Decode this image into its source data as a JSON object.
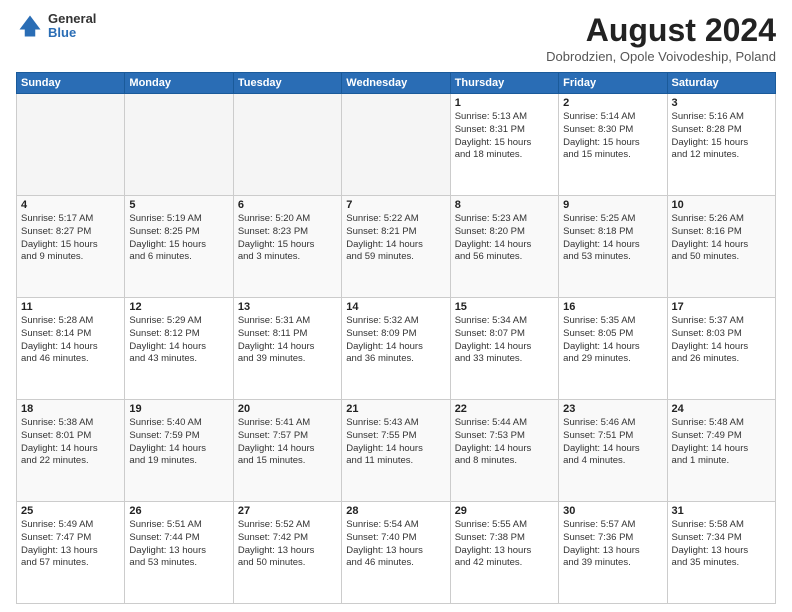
{
  "logo": {
    "general": "General",
    "blue": "Blue"
  },
  "title": "August 2024",
  "location": "Dobrodzien, Opole Voivodeship, Poland",
  "headers": [
    "Sunday",
    "Monday",
    "Tuesday",
    "Wednesday",
    "Thursday",
    "Friday",
    "Saturday"
  ],
  "rows": [
    [
      {
        "day": "",
        "lines": []
      },
      {
        "day": "",
        "lines": []
      },
      {
        "day": "",
        "lines": []
      },
      {
        "day": "",
        "lines": []
      },
      {
        "day": "1",
        "lines": [
          "Sunrise: 5:13 AM",
          "Sunset: 8:31 PM",
          "Daylight: 15 hours",
          "and 18 minutes."
        ]
      },
      {
        "day": "2",
        "lines": [
          "Sunrise: 5:14 AM",
          "Sunset: 8:30 PM",
          "Daylight: 15 hours",
          "and 15 minutes."
        ]
      },
      {
        "day": "3",
        "lines": [
          "Sunrise: 5:16 AM",
          "Sunset: 8:28 PM",
          "Daylight: 15 hours",
          "and 12 minutes."
        ]
      }
    ],
    [
      {
        "day": "4",
        "lines": [
          "Sunrise: 5:17 AM",
          "Sunset: 8:27 PM",
          "Daylight: 15 hours",
          "and 9 minutes."
        ]
      },
      {
        "day": "5",
        "lines": [
          "Sunrise: 5:19 AM",
          "Sunset: 8:25 PM",
          "Daylight: 15 hours",
          "and 6 minutes."
        ]
      },
      {
        "day": "6",
        "lines": [
          "Sunrise: 5:20 AM",
          "Sunset: 8:23 PM",
          "Daylight: 15 hours",
          "and 3 minutes."
        ]
      },
      {
        "day": "7",
        "lines": [
          "Sunrise: 5:22 AM",
          "Sunset: 8:21 PM",
          "Daylight: 14 hours",
          "and 59 minutes."
        ]
      },
      {
        "day": "8",
        "lines": [
          "Sunrise: 5:23 AM",
          "Sunset: 8:20 PM",
          "Daylight: 14 hours",
          "and 56 minutes."
        ]
      },
      {
        "day": "9",
        "lines": [
          "Sunrise: 5:25 AM",
          "Sunset: 8:18 PM",
          "Daylight: 14 hours",
          "and 53 minutes."
        ]
      },
      {
        "day": "10",
        "lines": [
          "Sunrise: 5:26 AM",
          "Sunset: 8:16 PM",
          "Daylight: 14 hours",
          "and 50 minutes."
        ]
      }
    ],
    [
      {
        "day": "11",
        "lines": [
          "Sunrise: 5:28 AM",
          "Sunset: 8:14 PM",
          "Daylight: 14 hours",
          "and 46 minutes."
        ]
      },
      {
        "day": "12",
        "lines": [
          "Sunrise: 5:29 AM",
          "Sunset: 8:12 PM",
          "Daylight: 14 hours",
          "and 43 minutes."
        ]
      },
      {
        "day": "13",
        "lines": [
          "Sunrise: 5:31 AM",
          "Sunset: 8:11 PM",
          "Daylight: 14 hours",
          "and 39 minutes."
        ]
      },
      {
        "day": "14",
        "lines": [
          "Sunrise: 5:32 AM",
          "Sunset: 8:09 PM",
          "Daylight: 14 hours",
          "and 36 minutes."
        ]
      },
      {
        "day": "15",
        "lines": [
          "Sunrise: 5:34 AM",
          "Sunset: 8:07 PM",
          "Daylight: 14 hours",
          "and 33 minutes."
        ]
      },
      {
        "day": "16",
        "lines": [
          "Sunrise: 5:35 AM",
          "Sunset: 8:05 PM",
          "Daylight: 14 hours",
          "and 29 minutes."
        ]
      },
      {
        "day": "17",
        "lines": [
          "Sunrise: 5:37 AM",
          "Sunset: 8:03 PM",
          "Daylight: 14 hours",
          "and 26 minutes."
        ]
      }
    ],
    [
      {
        "day": "18",
        "lines": [
          "Sunrise: 5:38 AM",
          "Sunset: 8:01 PM",
          "Daylight: 14 hours",
          "and 22 minutes."
        ]
      },
      {
        "day": "19",
        "lines": [
          "Sunrise: 5:40 AM",
          "Sunset: 7:59 PM",
          "Daylight: 14 hours",
          "and 19 minutes."
        ]
      },
      {
        "day": "20",
        "lines": [
          "Sunrise: 5:41 AM",
          "Sunset: 7:57 PM",
          "Daylight: 14 hours",
          "and 15 minutes."
        ]
      },
      {
        "day": "21",
        "lines": [
          "Sunrise: 5:43 AM",
          "Sunset: 7:55 PM",
          "Daylight: 14 hours",
          "and 11 minutes."
        ]
      },
      {
        "day": "22",
        "lines": [
          "Sunrise: 5:44 AM",
          "Sunset: 7:53 PM",
          "Daylight: 14 hours",
          "and 8 minutes."
        ]
      },
      {
        "day": "23",
        "lines": [
          "Sunrise: 5:46 AM",
          "Sunset: 7:51 PM",
          "Daylight: 14 hours",
          "and 4 minutes."
        ]
      },
      {
        "day": "24",
        "lines": [
          "Sunrise: 5:48 AM",
          "Sunset: 7:49 PM",
          "Daylight: 14 hours",
          "and 1 minute."
        ]
      }
    ],
    [
      {
        "day": "25",
        "lines": [
          "Sunrise: 5:49 AM",
          "Sunset: 7:47 PM",
          "Daylight: 13 hours",
          "and 57 minutes."
        ]
      },
      {
        "day": "26",
        "lines": [
          "Sunrise: 5:51 AM",
          "Sunset: 7:44 PM",
          "Daylight: 13 hours",
          "and 53 minutes."
        ]
      },
      {
        "day": "27",
        "lines": [
          "Sunrise: 5:52 AM",
          "Sunset: 7:42 PM",
          "Daylight: 13 hours",
          "and 50 minutes."
        ]
      },
      {
        "day": "28",
        "lines": [
          "Sunrise: 5:54 AM",
          "Sunset: 7:40 PM",
          "Daylight: 13 hours",
          "and 46 minutes."
        ]
      },
      {
        "day": "29",
        "lines": [
          "Sunrise: 5:55 AM",
          "Sunset: 7:38 PM",
          "Daylight: 13 hours",
          "and 42 minutes."
        ]
      },
      {
        "day": "30",
        "lines": [
          "Sunrise: 5:57 AM",
          "Sunset: 7:36 PM",
          "Daylight: 13 hours",
          "and 39 minutes."
        ]
      },
      {
        "day": "31",
        "lines": [
          "Sunrise: 5:58 AM",
          "Sunset: 7:34 PM",
          "Daylight: 13 hours",
          "and 35 minutes."
        ]
      }
    ]
  ]
}
